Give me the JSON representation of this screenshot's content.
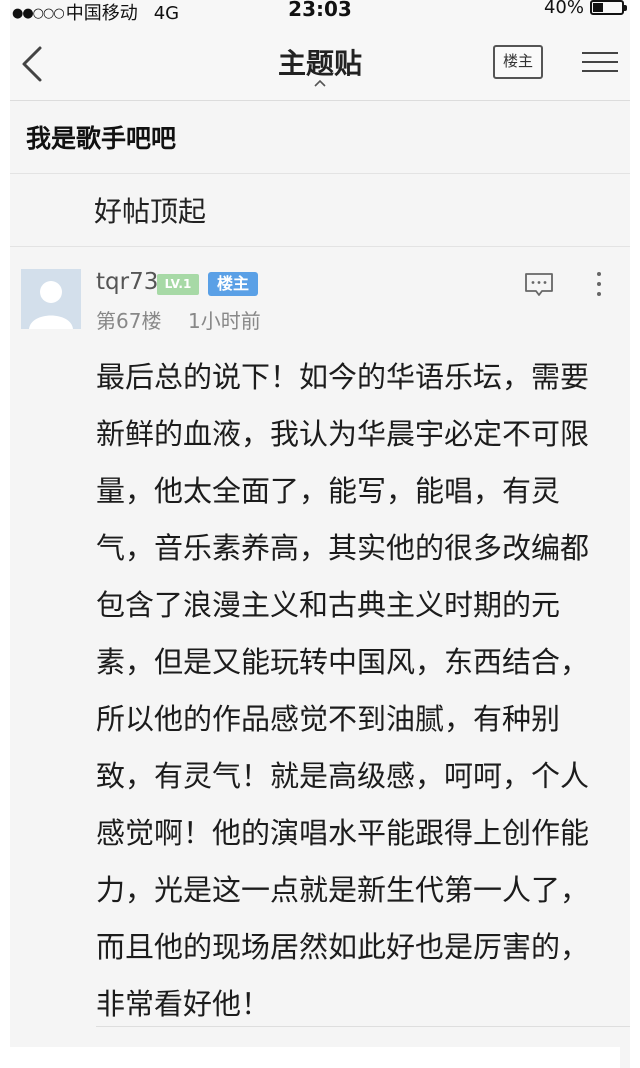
{
  "status_bar": {
    "carrier": "中国移动",
    "network": "4G",
    "time": "23:03",
    "battery": "40%",
    "battery_level": 0.4
  },
  "nav": {
    "title": "主题贴",
    "louzhu_button": "楼主",
    "back_icon": "chevron-left-icon",
    "menu_icon": "hamburger-menu-icon",
    "caret_icon": "caret-up-icon"
  },
  "forum": {
    "name": "我是歌手吧吧"
  },
  "thread": {
    "title": "好帖顶起"
  },
  "post": {
    "username": "tqr73",
    "level_badge": "LV.1",
    "owner_badge": "楼主",
    "floor": "第67楼",
    "time": "1小时前",
    "content": "最后总的说下！如今的华语乐坛，需要新鲜的血液，我认为华晨宇必定不可限量，他太全面了，能写，能唱，有灵气，音乐素养高，其实他的很多改编都包含了浪漫主义和古典主义时期的元素，但是又能玩转中国风，东西结合，所以他的作品感觉不到油腻，有种别致，有灵气！就是高级感，呵呵，个人感觉啊！他的演唱水平能跟得上创作能力，光是这一点就是新生代第一人了，而且他的现场居然如此好也是厉害的，非常看好他！",
    "reply_icon": "comment-bubble-icon",
    "more_icon": "more-vertical-icon"
  },
  "colors": {
    "level_badge": "#a7d9a6",
    "owner_badge": "#5aa0e6",
    "background": "#f5f5f5"
  }
}
